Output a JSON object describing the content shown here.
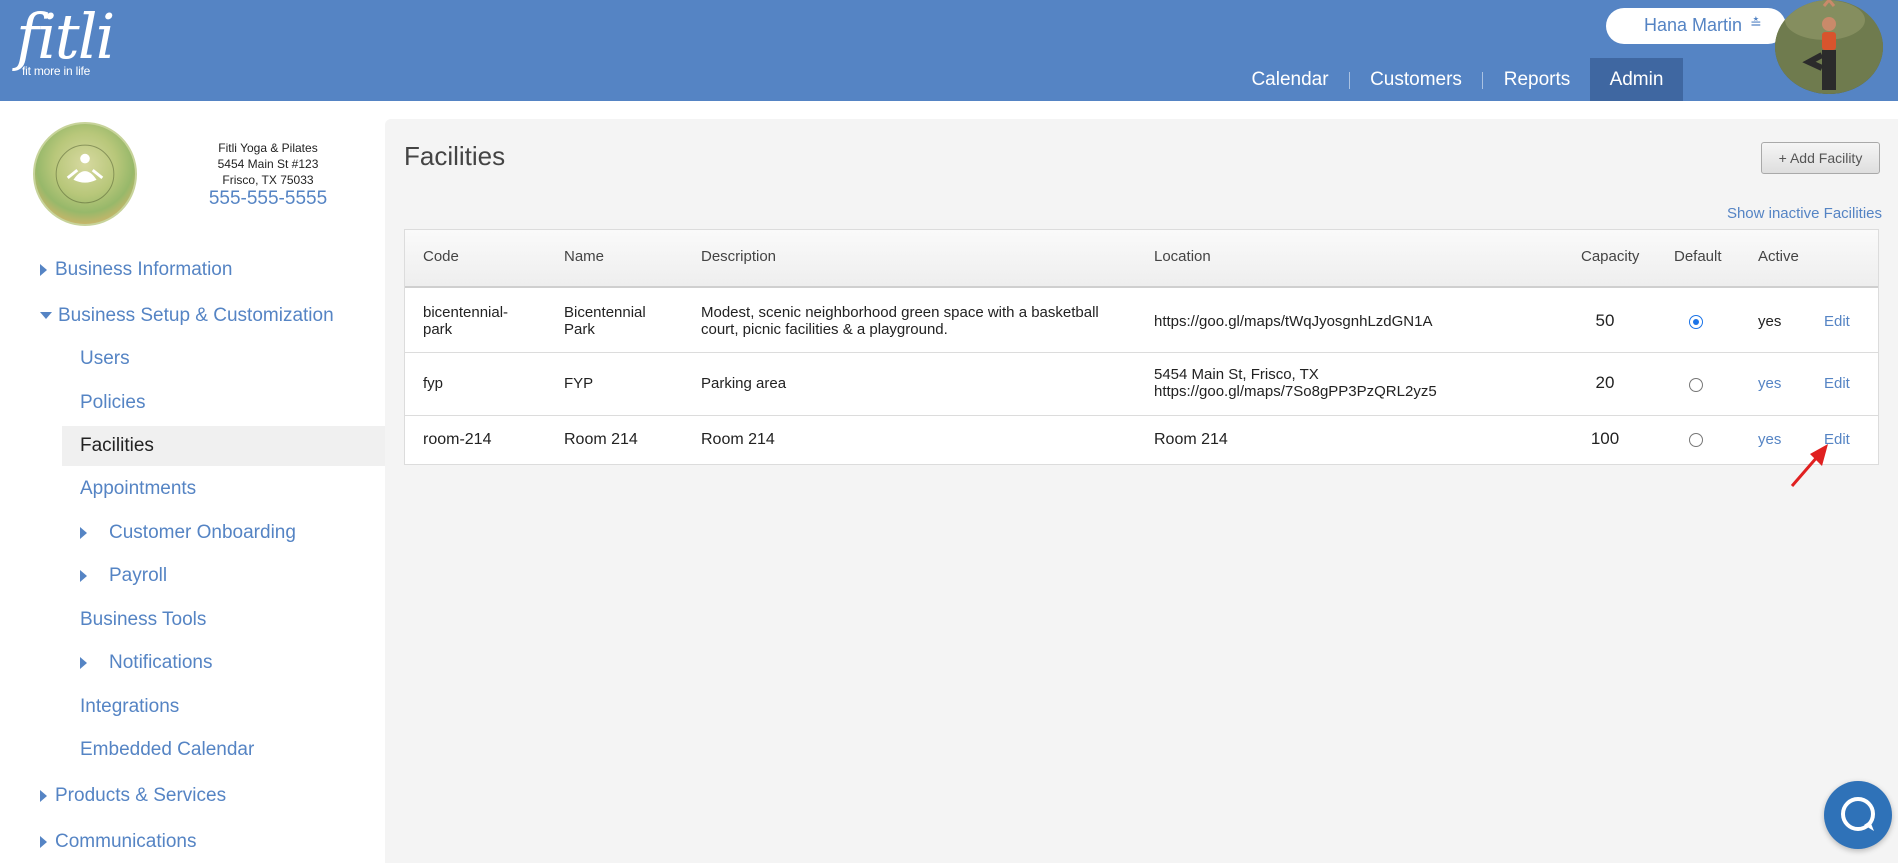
{
  "brand": {
    "name": "fitli",
    "tagline": "fit more in life"
  },
  "user": {
    "name": "Hana Martin",
    "menu_icon": "double-chevron-down-icon"
  },
  "nav": {
    "items": [
      "Calendar",
      "Customers",
      "Reports",
      "Admin"
    ],
    "active": "Admin"
  },
  "business": {
    "name": "Fitli Yoga & Pilates",
    "address1": "5454 Main St #123",
    "address2": "Frisco, TX 75033",
    "phone": "555-555-5555"
  },
  "sidebar": {
    "items": [
      {
        "label": "Business Information",
        "expander": "right"
      },
      {
        "label": "Business Setup & Customization",
        "expander": "down"
      },
      {
        "label": "Users"
      },
      {
        "label": "Policies"
      },
      {
        "label": "Facilities",
        "active": true
      },
      {
        "label": "Appointments"
      },
      {
        "label": "Customer Onboarding",
        "expander": "right"
      },
      {
        "label": "Payroll",
        "expander": "right"
      },
      {
        "label": "Business Tools"
      },
      {
        "label": "Notifications",
        "expander": "right"
      },
      {
        "label": "Integrations"
      },
      {
        "label": "Embedded Calendar"
      },
      {
        "label": "Products & Services",
        "expander": "right"
      },
      {
        "label": "Communications",
        "expander": "right"
      }
    ]
  },
  "page": {
    "title": "Facilities",
    "add_button": "+ Add Facility",
    "show_inactive": "Show inactive Facilities"
  },
  "table": {
    "headers": [
      "Code",
      "Name",
      "Description",
      "Location",
      "Capacity",
      "Default",
      "Active"
    ],
    "rows": [
      {
        "code_line1": "bicentennial-",
        "code_line2": "park",
        "name_line1": "Bicentennial",
        "name_line2": "Park",
        "desc_line1": "Modest, scenic neighborhood green space with a basketball",
        "desc_line2": "court, picnic facilities & a playground.",
        "location_line1": "https://goo.gl/maps/tWqJyosgnhLzdGN1A",
        "capacity": "50",
        "default": true,
        "active": "yes",
        "edit": "Edit"
      },
      {
        "code": "fyp",
        "name": "FYP",
        "desc": "Parking area",
        "location_line1": "5454 Main St, Frisco, TX",
        "location_line2": "https://goo.gl/maps/7So8gPP3PzQRL2yz5",
        "capacity": "20",
        "default": false,
        "active": "yes",
        "edit": "Edit"
      },
      {
        "code": "room-214",
        "name": "Room 214",
        "desc": "Room 214",
        "location_line1": "Room 214",
        "capacity": "100",
        "default": false,
        "active": "yes",
        "edit": "Edit"
      }
    ]
  },
  "colors": {
    "header_bg": "#5584c4",
    "nav_active_bg": "#3f67a1",
    "link": "#5584c4",
    "annotation_arrow": "#e02020",
    "chat_bg": "#2f72b8"
  }
}
